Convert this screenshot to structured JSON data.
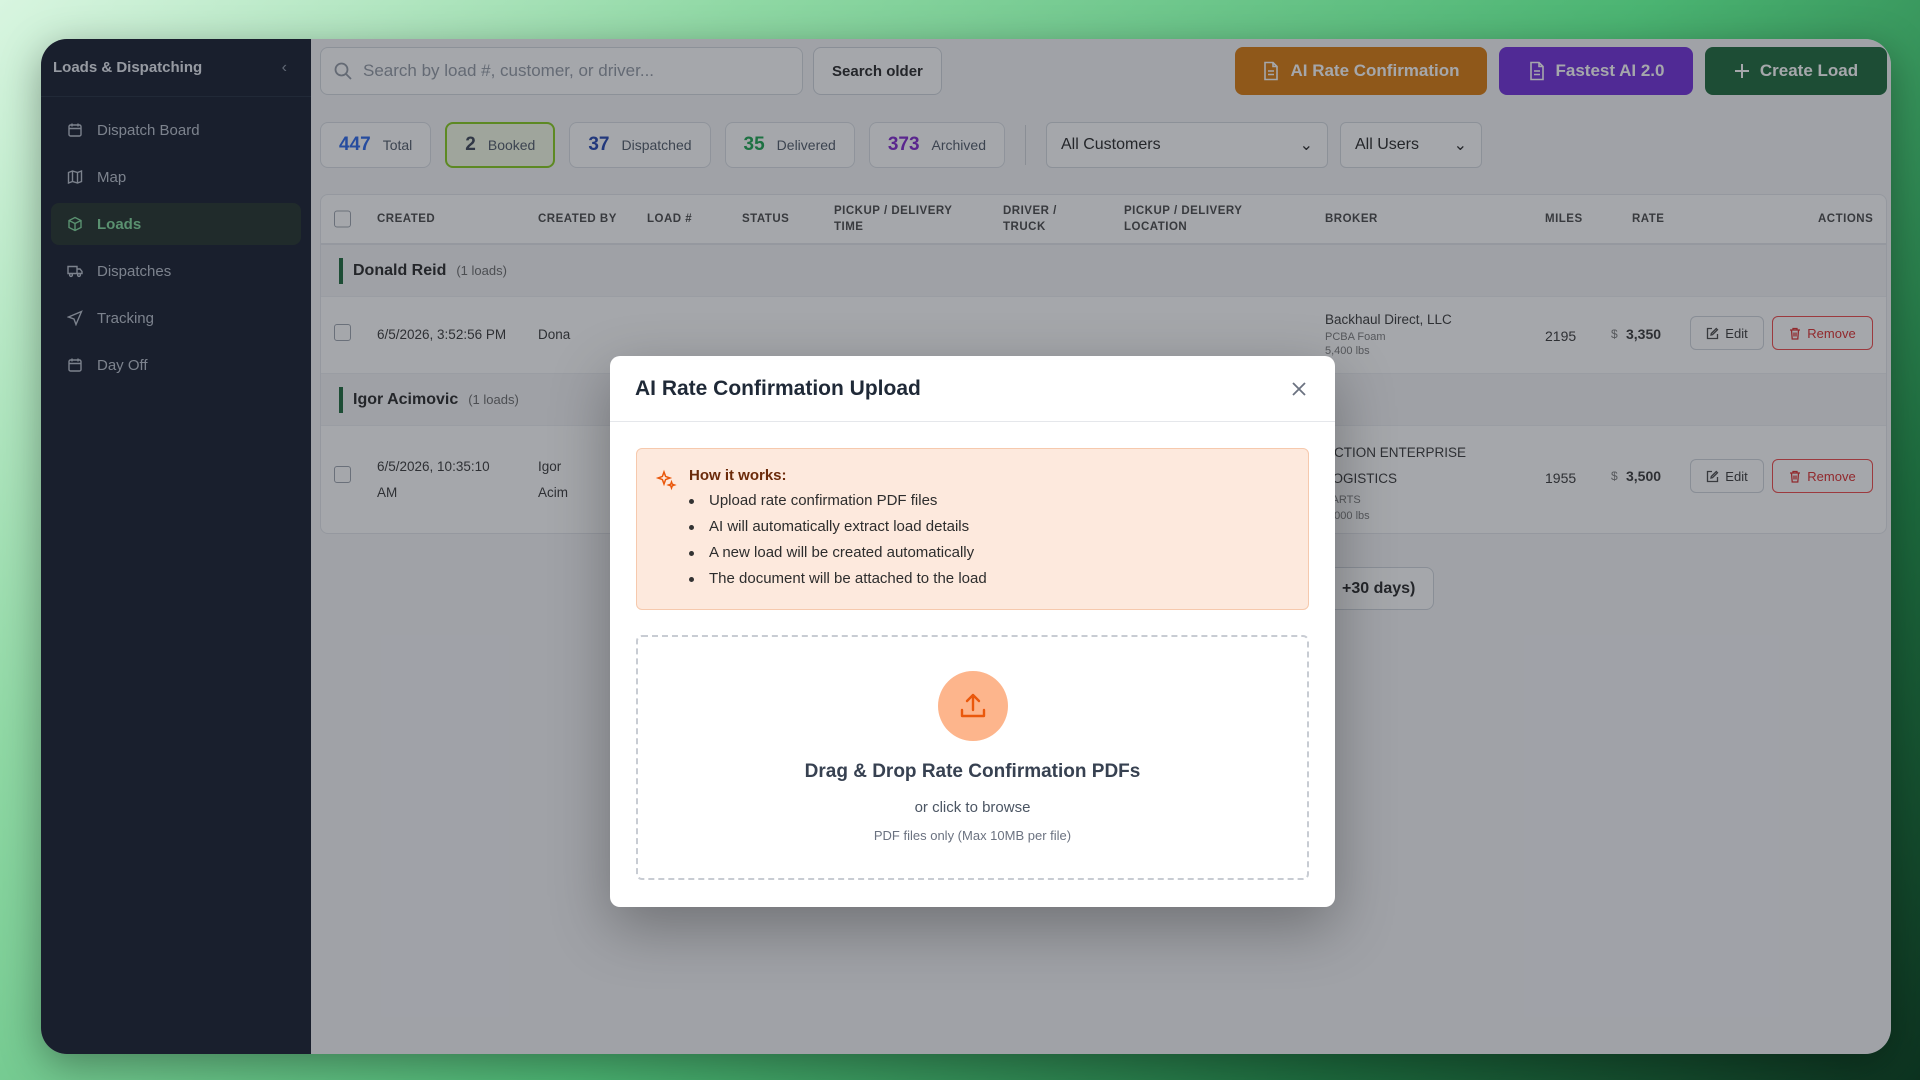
{
  "sidebar": {
    "title": "Loads & Dispatching",
    "items": [
      {
        "label": "Dispatch Board",
        "icon": "calendar-icon"
      },
      {
        "label": "Map",
        "icon": "map-icon"
      },
      {
        "label": "Loads",
        "icon": "package-icon",
        "active": true
      },
      {
        "label": "Dispatches",
        "icon": "truck-icon"
      },
      {
        "label": "Tracking",
        "icon": "navigation-icon"
      },
      {
        "label": "Day Off",
        "icon": "calendar-icon"
      }
    ]
  },
  "topbar": {
    "search_placeholder": "Search by load #, customer, or driver...",
    "search_older": "Search older",
    "ai_rate_confirmation": "AI Rate Confirmation",
    "fastest_ai": "Fastest AI 2.0",
    "create_load": "Create Load"
  },
  "stats": [
    {
      "num": "447",
      "label": "Total",
      "color": "#2563eb"
    },
    {
      "num": "2",
      "label": "Booked",
      "color": "#374151"
    },
    {
      "num": "37",
      "label": "Dispatched",
      "color": "#1e40af"
    },
    {
      "num": "35",
      "label": "Delivered",
      "color": "#16a34a"
    },
    {
      "num": "373",
      "label": "Archived",
      "color": "#7e22ce"
    }
  ],
  "filters": {
    "customers": "All Customers",
    "users": "All Users"
  },
  "table": {
    "headers": {
      "created": "CREATED",
      "created_by": "CREATED BY",
      "load": "LOAD #",
      "status": "STATUS",
      "time_1": "PICKUP / DELIVERY",
      "time_2": "TIME",
      "driver_1": "DRIVER /",
      "driver_2": "TRUCK",
      "loc_1": "PICKUP / DELIVERY",
      "loc_2": "LOCATION",
      "broker": "BROKER",
      "miles": "MILES",
      "rate": "RATE",
      "actions": "ACTIONS"
    },
    "groups": [
      {
        "name": "Donald Reid",
        "count": "(1 loads)",
        "row": {
          "created": "6/5/2026, 3:52:56 PM",
          "created_by": "Dona",
          "broker": "Backhaul Direct, LLC",
          "commodity": "PCBA Foam",
          "weight": "5,400 lbs",
          "miles": "2195",
          "currency": "$",
          "rate": "3,350"
        }
      },
      {
        "name": "Igor Acimovic",
        "count": "(1 loads)",
        "row": {
          "created_1": "6/5/2026, 10:35:10",
          "created_2": "AM",
          "created_by_1": "Igor",
          "created_by_2": "Acim",
          "broker_1": "ACTION ENTERPRISE",
          "broker_2": "LOGISTICS",
          "commodity": "PARTS",
          "weight": "2,000 lbs",
          "miles": "1955",
          "currency": "$",
          "rate": "3,500"
        }
      }
    ],
    "edit": "Edit",
    "remove": "Remove"
  },
  "days_button": "+30 days)",
  "modal": {
    "title": "AI Rate Confirmation Upload",
    "how_title": "How it works:",
    "steps": [
      "Upload rate confirmation PDF files",
      "AI will automatically extract load details",
      "A new load will be created automatically",
      "The document will be attached to the load"
    ],
    "drop_title": "Drag & Drop Rate Confirmation PDFs",
    "drop_sub": "or click to browse",
    "drop_hint": "PDF files only (Max 10MB per file)"
  }
}
